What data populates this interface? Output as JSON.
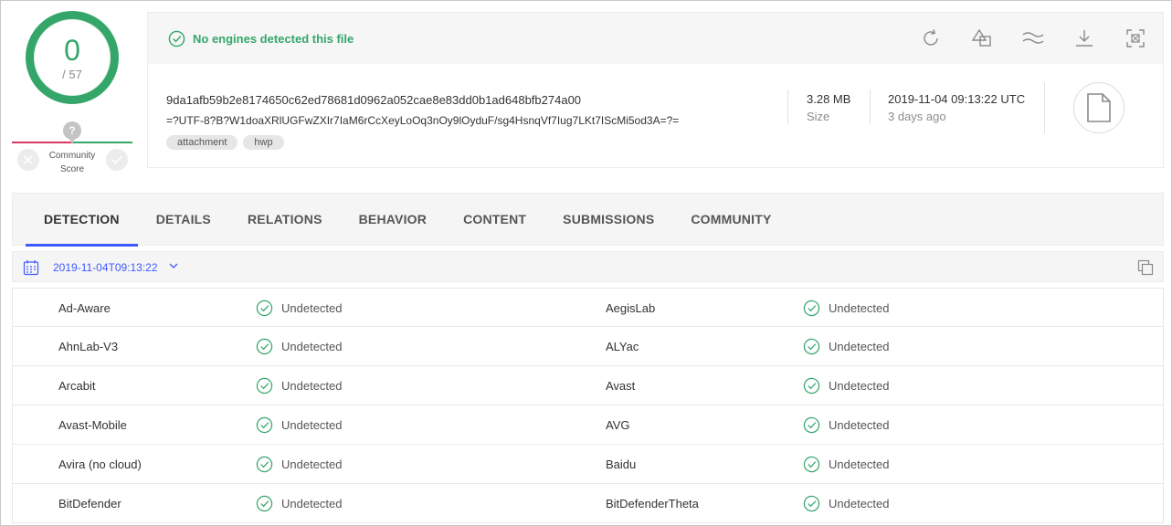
{
  "score": {
    "detected": "0",
    "total": "/ 57"
  },
  "community": {
    "question": "?",
    "label_line1": "Community",
    "label_line2": "Score"
  },
  "status": {
    "text": "No engines detected this file"
  },
  "file": {
    "hash": "9da1afb59b2e8174650c62ed78681d0962a052cae8e83dd0b1ad648bfb274a00",
    "name": "=?UTF-8?B?W1doaXRlUGFwZXIr7IaM6rCcXeyLoOq3nOy9lOyduF/sg4HsnqVf7Iug7LKt7IScMi5od3A=?=",
    "tags": [
      "attachment",
      "hwp"
    ],
    "size_value": "3.28 MB",
    "size_label": "Size",
    "date_value": "2019-11-04 09:13:22 UTC",
    "date_relative": "3 days ago"
  },
  "tabs": [
    "DETECTION",
    "DETAILS",
    "RELATIONS",
    "BEHAVIOR",
    "CONTENT",
    "SUBMISSIONS",
    "COMMUNITY"
  ],
  "analysis_date": "2019-11-04T09:13:22",
  "results": [
    {
      "left_engine": "Ad-Aware",
      "left_result": "Undetected",
      "right_engine": "AegisLab",
      "right_result": "Undetected"
    },
    {
      "left_engine": "AhnLab-V3",
      "left_result": "Undetected",
      "right_engine": "ALYac",
      "right_result": "Undetected"
    },
    {
      "left_engine": "Arcabit",
      "left_result": "Undetected",
      "right_engine": "Avast",
      "right_result": "Undetected"
    },
    {
      "left_engine": "Avast-Mobile",
      "left_result": "Undetected",
      "right_engine": "AVG",
      "right_result": "Undetected"
    },
    {
      "left_engine": "Avira (no cloud)",
      "left_result": "Undetected",
      "right_engine": "Baidu",
      "right_result": "Undetected"
    },
    {
      "left_engine": "BitDefender",
      "left_result": "Undetected",
      "right_engine": "BitDefenderTheta",
      "right_result": "Undetected"
    }
  ],
  "colors": {
    "clean": "#35a66a",
    "accent": "#3d5afe",
    "malicious": "#d7385e"
  }
}
